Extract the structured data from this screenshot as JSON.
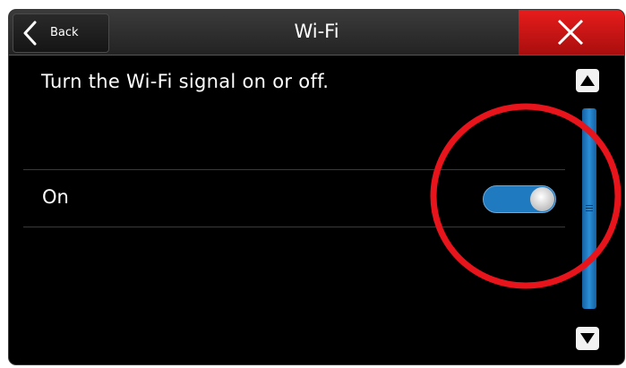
{
  "header": {
    "back_label": "Back",
    "title": "Wi-Fi"
  },
  "main": {
    "description": "Turn the Wi-Fi signal on or off.",
    "setting": {
      "label": "On",
      "state": "on"
    }
  },
  "icons": {
    "back": "chevron-left-icon",
    "close": "close-icon",
    "scroll_up": "triangle-up-icon",
    "scroll_down": "triangle-down-icon"
  },
  "colors": {
    "close_button": "#d11515",
    "toggle_on": "#1f7ac0",
    "scrollbar": "#2a8fd8",
    "annotation": "#e8141c"
  }
}
